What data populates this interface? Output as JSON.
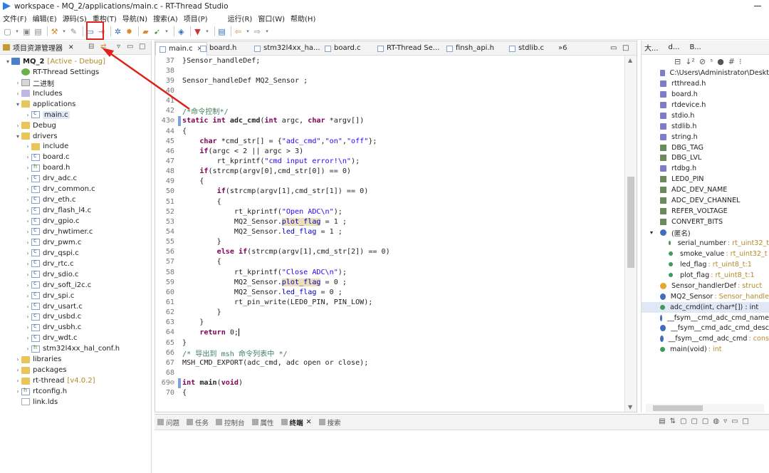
{
  "window": {
    "title": "workspace - MQ_2/applications/main.c - RT-Thread Studio"
  },
  "menu": [
    "文件(F)",
    "编辑(E)",
    "源码(S)",
    "重构(T)",
    "导航(N)",
    "搜索(A)",
    "项目(P)",
    "运行(R)",
    "窗口(W)",
    "帮助(H)"
  ],
  "explorer": {
    "title": "项目资源管理器",
    "items": [
      {
        "label": "MQ_2",
        "deco": "[Active - Debug]",
        "icon": "project-icon",
        "level": 0,
        "arrow": "▾",
        "bold": true
      },
      {
        "label": "RT-Thread Settings",
        "icon": "settings-icon",
        "level": 1,
        "arrow": ""
      },
      {
        "label": "二进制",
        "icon": "binary-icon",
        "level": 1,
        "arrow": "›"
      },
      {
        "label": "Includes",
        "icon": "includes-icon",
        "level": 1,
        "arrow": "›"
      },
      {
        "label": "applications",
        "icon": "folder-icon",
        "level": 1,
        "arrow": "▾"
      },
      {
        "label": "main.c",
        "icon": "c-file-icon",
        "level": 2,
        "arrow": "›",
        "selected": true
      },
      {
        "label": "Debug",
        "icon": "folder-icon",
        "level": 1,
        "arrow": "›"
      },
      {
        "label": "drivers",
        "icon": "folder-icon",
        "level": 1,
        "arrow": "▾"
      },
      {
        "label": "include",
        "icon": "folder-icon",
        "level": 2,
        "arrow": "›"
      },
      {
        "label": "board.c",
        "icon": "c-file-icon",
        "level": 2,
        "arrow": "›"
      },
      {
        "label": "board.h",
        "icon": "h-file-icon",
        "level": 2,
        "arrow": "›"
      },
      {
        "label": "drv_adc.c",
        "icon": "c-file-icon",
        "level": 2,
        "arrow": "›"
      },
      {
        "label": "drv_common.c",
        "icon": "c-file-icon",
        "level": 2,
        "arrow": "›"
      },
      {
        "label": "drv_eth.c",
        "icon": "c-file-icon",
        "level": 2,
        "arrow": "›"
      },
      {
        "label": "drv_flash_l4.c",
        "icon": "c-file-icon",
        "level": 2,
        "arrow": "›"
      },
      {
        "label": "drv_gpio.c",
        "icon": "c-file-icon",
        "level": 2,
        "arrow": "›"
      },
      {
        "label": "drv_hwtimer.c",
        "icon": "c-file-icon",
        "level": 2,
        "arrow": "›"
      },
      {
        "label": "drv_pwm.c",
        "icon": "c-file-icon",
        "level": 2,
        "arrow": "›"
      },
      {
        "label": "drv_qspi.c",
        "icon": "c-file-icon",
        "level": 2,
        "arrow": "›"
      },
      {
        "label": "drv_rtc.c",
        "icon": "c-file-icon",
        "level": 2,
        "arrow": "›"
      },
      {
        "label": "drv_sdio.c",
        "icon": "c-file-icon",
        "level": 2,
        "arrow": "›"
      },
      {
        "label": "drv_soft_i2c.c",
        "icon": "c-file-icon",
        "level": 2,
        "arrow": "›"
      },
      {
        "label": "drv_spi.c",
        "icon": "c-file-icon",
        "level": 2,
        "arrow": "›"
      },
      {
        "label": "drv_usart.c",
        "icon": "c-file-icon",
        "level": 2,
        "arrow": "›"
      },
      {
        "label": "drv_usbd.c",
        "icon": "c-file-icon",
        "level": 2,
        "arrow": "›"
      },
      {
        "label": "drv_usbh.c",
        "icon": "c-file-icon",
        "level": 2,
        "arrow": "›"
      },
      {
        "label": "drv_wdt.c",
        "icon": "c-file-icon",
        "level": 2,
        "arrow": "›"
      },
      {
        "label": "stm32l4xx_hal_conf.h",
        "icon": "h-file-icon",
        "level": 2,
        "arrow": "›"
      },
      {
        "label": "libraries",
        "icon": "folder-icon",
        "level": 1,
        "arrow": "›"
      },
      {
        "label": "packages",
        "icon": "folder-icon",
        "level": 1,
        "arrow": "›"
      },
      {
        "label": "rt-thread",
        "deco": "[v4.0.2]",
        "icon": "folder-icon",
        "level": 1,
        "arrow": "›"
      },
      {
        "label": "rtconfig.h",
        "icon": "h-file-icon",
        "level": 1,
        "arrow": "›"
      },
      {
        "label": "link.lds",
        "icon": "file-icon",
        "level": 1,
        "arrow": ""
      }
    ]
  },
  "editor": {
    "tabs": [
      {
        "label": "main.c",
        "active": true
      },
      {
        "label": "board.h"
      },
      {
        "label": "stm32l4xx_ha..."
      },
      {
        "label": "board.c"
      },
      {
        "label": "RT-Thread Se..."
      },
      {
        "label": "finsh_api.h"
      },
      {
        "label": "stdlib.c"
      }
    ],
    "more": "»6",
    "lines": [
      {
        "n": "37",
        "segs": [
          [
            "",
            "}Sensor_handleDef;"
          ]
        ]
      },
      {
        "n": "38",
        "segs": []
      },
      {
        "n": "39",
        "segs": [
          [
            "",
            "Sensor_handleDef MQ2_Sensor ;"
          ]
        ]
      },
      {
        "n": "40",
        "segs": []
      },
      {
        "n": "41",
        "segs": []
      },
      {
        "n": "42",
        "segs": [
          [
            "cm",
            "/*命令控制*/"
          ]
        ]
      },
      {
        "n": "43⊖",
        "segs": [
          [
            "kw",
            "static int "
          ],
          [
            "b",
            "adc_cmd"
          ],
          [
            "",
            "("
          ],
          [
            "kw",
            "int"
          ],
          [
            "",
            " argc, "
          ],
          [
            "kw",
            "char"
          ],
          [
            "",
            " *argv[])"
          ]
        ],
        "mark": true
      },
      {
        "n": "44",
        "segs": [
          [
            "",
            "{"
          ]
        ]
      },
      {
        "n": "45",
        "segs": [
          [
            "",
            "    "
          ],
          [
            "kw",
            "char"
          ],
          [
            "",
            " *cmd_str[] = {"
          ],
          [
            "str",
            "\"adc_cmd\""
          ],
          [
            "",
            ","
          ],
          [
            "str",
            "\"on\""
          ],
          [
            "",
            ","
          ],
          [
            "str",
            "\"off\""
          ],
          [
            "",
            "};"
          ]
        ]
      },
      {
        "n": "46",
        "segs": [
          [
            "",
            "    "
          ],
          [
            "kw",
            "if"
          ],
          [
            "",
            "(argc < 2 || argc > 3)"
          ]
        ]
      },
      {
        "n": "47",
        "segs": [
          [
            "",
            "        rt_kprintf("
          ],
          [
            "str",
            "\"cmd input error!\\n\""
          ],
          [
            "",
            ");"
          ]
        ]
      },
      {
        "n": "48",
        "segs": [
          [
            "",
            "    "
          ],
          [
            "kw",
            "if"
          ],
          [
            "",
            "(strcmp(argv[0],cmd_str[0]) == 0)"
          ]
        ]
      },
      {
        "n": "49",
        "segs": [
          [
            "",
            "    {"
          ]
        ]
      },
      {
        "n": "50",
        "segs": [
          [
            "",
            "        "
          ],
          [
            "kw",
            "if"
          ],
          [
            "",
            "(strcmp(argv[1],cmd_str[1]) == 0)"
          ]
        ]
      },
      {
        "n": "51",
        "segs": [
          [
            "",
            "        {"
          ]
        ]
      },
      {
        "n": "52",
        "segs": [
          [
            "",
            "            rt_kprintf("
          ],
          [
            "str",
            "\"Open ADC\\n\""
          ],
          [
            "",
            ");"
          ]
        ]
      },
      {
        "n": "53",
        "segs": [
          [
            "",
            "            MQ2_Sensor."
          ],
          [
            "fldhl",
            "plot_flag"
          ],
          [
            "",
            " = 1 ;"
          ]
        ]
      },
      {
        "n": "54",
        "segs": [
          [
            "",
            "            MQ2_Sensor."
          ],
          [
            "fld",
            "led_flag"
          ],
          [
            "",
            " = 1 ;"
          ]
        ]
      },
      {
        "n": "55",
        "segs": [
          [
            "",
            "        }"
          ]
        ]
      },
      {
        "n": "56",
        "segs": [
          [
            "",
            "        "
          ],
          [
            "kw",
            "else if"
          ],
          [
            "",
            "(strcmp(argv[1],cmd_str[2]) == 0)"
          ]
        ]
      },
      {
        "n": "57",
        "segs": [
          [
            "",
            "        {"
          ]
        ]
      },
      {
        "n": "58",
        "segs": [
          [
            "",
            "            rt_kprintf("
          ],
          [
            "str",
            "\"Close ADC\\n\""
          ],
          [
            "",
            ");"
          ]
        ]
      },
      {
        "n": "59",
        "segs": [
          [
            "",
            "            MQ2_Sensor."
          ],
          [
            "fldhl",
            "plot_flag"
          ],
          [
            "",
            " = 0 ;"
          ]
        ]
      },
      {
        "n": "60",
        "segs": [
          [
            "",
            "            MQ2_Sensor."
          ],
          [
            "fld",
            "led_flag"
          ],
          [
            "",
            " = 0 ;"
          ]
        ]
      },
      {
        "n": "61",
        "segs": [
          [
            "",
            "            rt_pin_write(LED0_PIN, PIN_LOW);"
          ]
        ]
      },
      {
        "n": "62",
        "segs": [
          [
            "",
            "        }"
          ]
        ]
      },
      {
        "n": "63",
        "segs": [
          [
            "",
            "    }"
          ]
        ]
      },
      {
        "n": "64",
        "segs": [
          [
            "",
            "    "
          ],
          [
            "kw",
            "return"
          ],
          [
            "",
            " 0;"
          ],
          [
            "caret",
            ""
          ]
        ]
      },
      {
        "n": "65",
        "segs": [
          [
            "",
            "}"
          ]
        ]
      },
      {
        "n": "66",
        "segs": [
          [
            "cm",
            "/* 导出到 msh 命令列表中 */"
          ]
        ]
      },
      {
        "n": "67",
        "segs": [
          [
            "",
            "MSH_CMD_EXPORT(adc_cmd, adc open or close);"
          ]
        ]
      },
      {
        "n": "68",
        "segs": []
      },
      {
        "n": "69⊖",
        "segs": [
          [
            "kw",
            "int "
          ],
          [
            "b",
            "main"
          ],
          [
            "",
            "("
          ],
          [
            "kw",
            "void"
          ],
          [
            "",
            ")"
          ]
        ],
        "mark": true
      },
      {
        "n": "70",
        "segs": [
          [
            "",
            "{"
          ]
        ]
      }
    ]
  },
  "outline": {
    "tabs": [
      "大...",
      "d...",
      "B..."
    ],
    "items": [
      {
        "label": "C:\\Users\\Administrator\\Deskt",
        "icon": "include-icon",
        "indent": 0
      },
      {
        "label": "rtthread.h",
        "icon": "include-icon",
        "indent": 0
      },
      {
        "label": "board.h",
        "icon": "include-icon",
        "indent": 0
      },
      {
        "label": "rtdevice.h",
        "icon": "include-icon",
        "indent": 0
      },
      {
        "label": "stdio.h",
        "icon": "include-icon",
        "indent": 0
      },
      {
        "label": "stdlib.h",
        "icon": "include-icon",
        "indent": 0
      },
      {
        "label": "string.h",
        "icon": "include-icon",
        "indent": 0
      },
      {
        "label": "DBG_TAG",
        "icon": "macro-icon",
        "indent": 0
      },
      {
        "label": "DBG_LVL",
        "icon": "macro-icon",
        "indent": 0
      },
      {
        "label": "rtdbg.h",
        "icon": "include-icon",
        "indent": 0
      },
      {
        "label": "LED0_PIN",
        "icon": "macro-icon",
        "indent": 0
      },
      {
        "label": "ADC_DEV_NAME",
        "icon": "macro-icon",
        "indent": 0
      },
      {
        "label": "ADC_DEV_CHANNEL",
        "icon": "macro-icon",
        "indent": 0
      },
      {
        "label": "REFER_VOLTAGE",
        "icon": "macro-icon",
        "indent": 0
      },
      {
        "label": "CONVERT_BITS",
        "icon": "macro-icon",
        "indent": 0
      },
      {
        "label": "(匿名)",
        "icon": "struct-icon",
        "indent": 0,
        "arrow": "▾"
      },
      {
        "label": "serial_number",
        "type": " : rt_uint32_t",
        "icon": "field-icon",
        "indent": 1
      },
      {
        "label": "smoke_value",
        "type": " : rt_uint32_t",
        "icon": "field-icon",
        "indent": 1
      },
      {
        "label": "led_flag",
        "type": " : rt_uint8_t:1",
        "icon": "field-icon",
        "indent": 1
      },
      {
        "label": "plot_flag",
        "type": " : rt_uint8_t:1",
        "icon": "field-icon",
        "indent": 1
      },
      {
        "label": "Sensor_handlerDef",
        "type": " : struct",
        "icon": "typedef-icon",
        "indent": 0
      },
      {
        "label": "MQ2_Sensor",
        "type": " : Sensor_handle",
        "icon": "variable-icon",
        "indent": 0
      },
      {
        "label": "adc_cmd(int, char*[]) : int",
        "icon": "function-icon",
        "indent": 0,
        "selected": true
      },
      {
        "label": "__fsym__cmd_adc_cmd_name",
        "icon": "variable-icon",
        "indent": 0
      },
      {
        "label": "__fsym__cmd_adc_cmd_desc",
        "icon": "variable-icon",
        "indent": 0
      },
      {
        "label": "__fsym__cmd_adc_cmd",
        "type": " : cons",
        "icon": "variable-icon",
        "indent": 0
      },
      {
        "label": "main(void)",
        "type": " : int",
        "icon": "function-icon",
        "indent": 0
      }
    ]
  },
  "bottom": {
    "tabs": [
      {
        "label": "问题",
        "icon": "problems-icon"
      },
      {
        "label": "任务",
        "icon": "tasks-icon"
      },
      {
        "label": "控制台",
        "icon": "console-icon"
      },
      {
        "label": "属性",
        "icon": "properties-icon"
      },
      {
        "label": "终端",
        "icon": "terminal-icon",
        "active": true
      },
      {
        "label": "搜索",
        "icon": "search-icon"
      }
    ]
  },
  "colors": {
    "highlight_box": "#e0201a",
    "arrow": "#e0201a",
    "keyword": "#7f0055",
    "string": "#2a00ff",
    "comment": "#3f7f5f"
  }
}
